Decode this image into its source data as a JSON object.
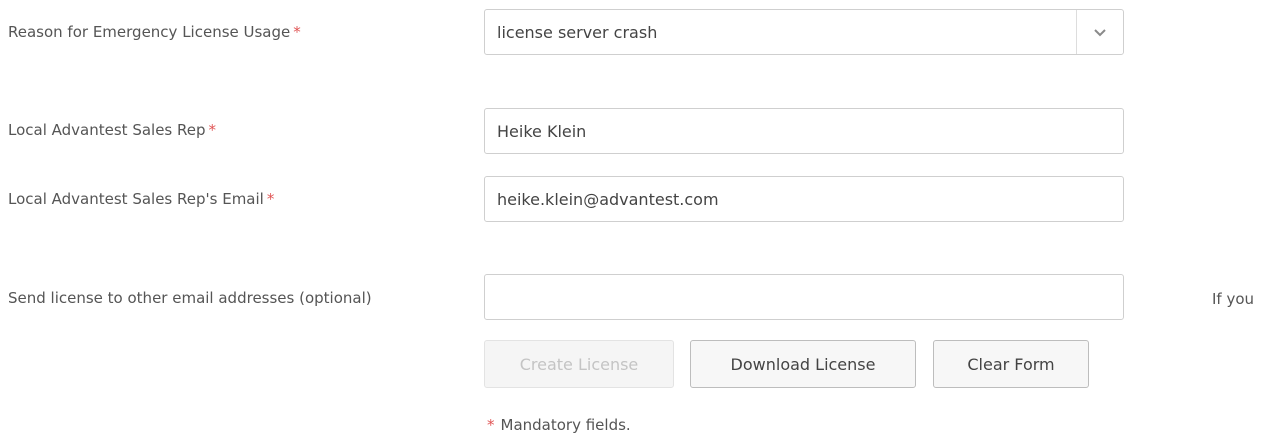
{
  "fields": {
    "reason": {
      "label": "Reason for Emergency License Usage",
      "required_mark": "*",
      "selected": "license server crash"
    },
    "sales_rep": {
      "label": "Local Advantest Sales Rep",
      "required_mark": "*",
      "value": "Heike Klein"
    },
    "sales_rep_email": {
      "label": "Local Advantest Sales Rep's Email",
      "required_mark": "*",
      "value": "heike.klein@advantest.com"
    },
    "other_emails": {
      "label": "Send license to other email addresses (optional)",
      "value": ""
    }
  },
  "buttons": {
    "create": "Create License",
    "download": "Download License",
    "clear": "Clear Form"
  },
  "side_text": "If you",
  "note": {
    "mark": "*",
    "text": "Mandatory fields."
  },
  "icons": {
    "dropdown": "chevron-down-icon"
  },
  "colors": {
    "required": "#e05555",
    "text": "#555555",
    "border": "#cfcfcf",
    "disabled_text": "#c4c4c4"
  }
}
